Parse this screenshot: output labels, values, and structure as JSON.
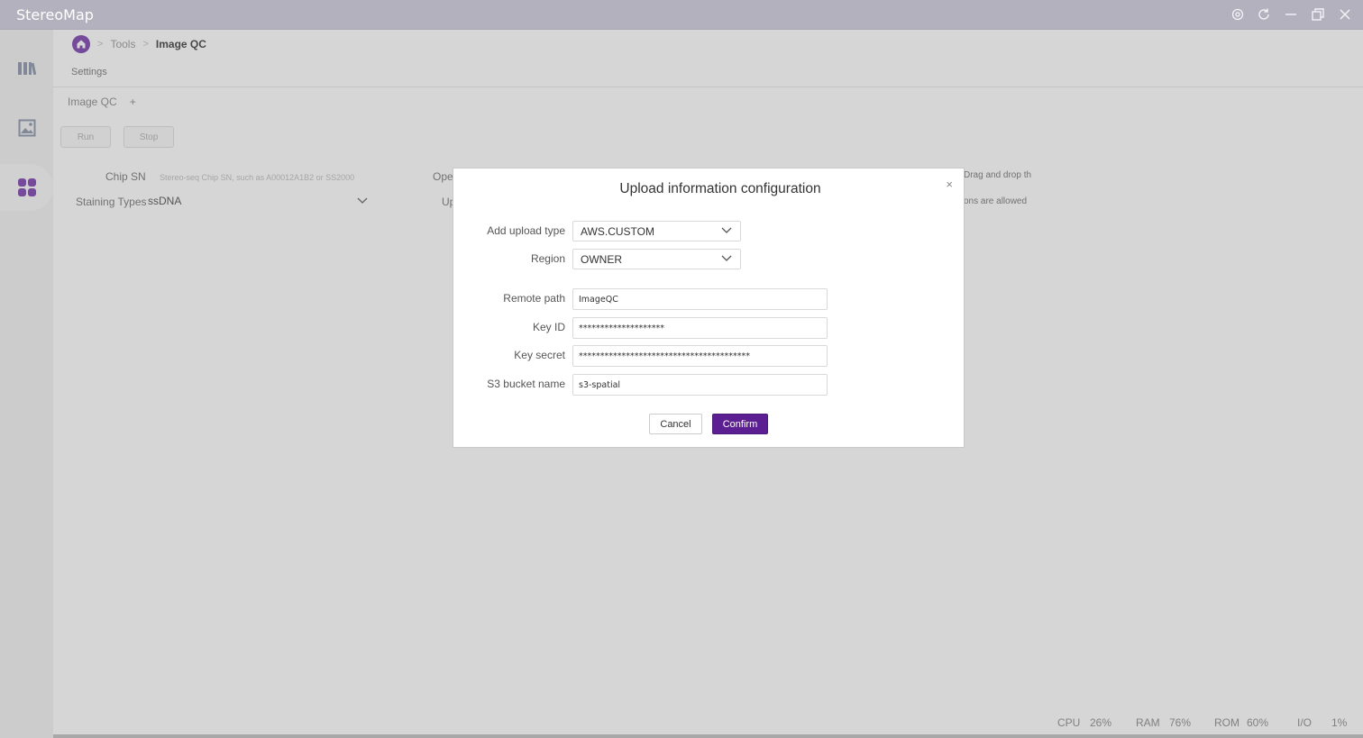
{
  "app": {
    "title": "StereoMap"
  },
  "breadcrumb": {
    "tools": "Tools",
    "current": "Image QC"
  },
  "main": {
    "settings_label": "Settings",
    "tab_label": "Image QC",
    "tab_add": "+",
    "run_label": "Run",
    "stop_label": "Stop",
    "chip_sn_label": "Chip SN",
    "chip_sn_placeholder": "Stereo-seq Chip SN, such as A00012A1B2 or SS2000",
    "operator_label": "Ope",
    "staining_label": "Staining Types",
    "staining_value": "ssDNA",
    "upload_label": "Up",
    "drag_hint": "Drag and drop th",
    "allowed_hint": "ons are allowed"
  },
  "modal": {
    "title": "Upload information configuration",
    "close": "×",
    "upload_type_label": "Add upload type",
    "upload_type_value": "AWS.CUSTOM",
    "region_label": "Region",
    "region_value": "OWNER",
    "remote_path_label": "Remote path",
    "remote_path_value": "ImageQC",
    "key_id_label": "Key ID",
    "key_id_value": "********************",
    "key_secret_label": "Key secret",
    "key_secret_value": "****************************************",
    "bucket_label": "S3 bucket name",
    "bucket_value": "s3-spatial",
    "cancel_label": "Cancel",
    "confirm_label": "Confirm"
  },
  "status": {
    "cpu_label": "CPU",
    "cpu_value": "26%",
    "ram_label": "RAM",
    "ram_value": "76%",
    "rom_label": "ROM",
    "rom_value": "60%",
    "io_label": "I/O",
    "io_value": "1%"
  },
  "icons": {
    "settings": "settings-icon",
    "refresh": "refresh-icon",
    "minimize": "minimize-icon",
    "restore": "restore-icon",
    "close": "close-icon",
    "home": "home-icon",
    "library": "library-icon",
    "image": "image-icon",
    "apps": "apps-icon",
    "chevron": "chevron-down-icon"
  },
  "colors": {
    "accent": "#5c1f91",
    "titlebar": "#b3b1bd",
    "home": "#8c59b8"
  }
}
